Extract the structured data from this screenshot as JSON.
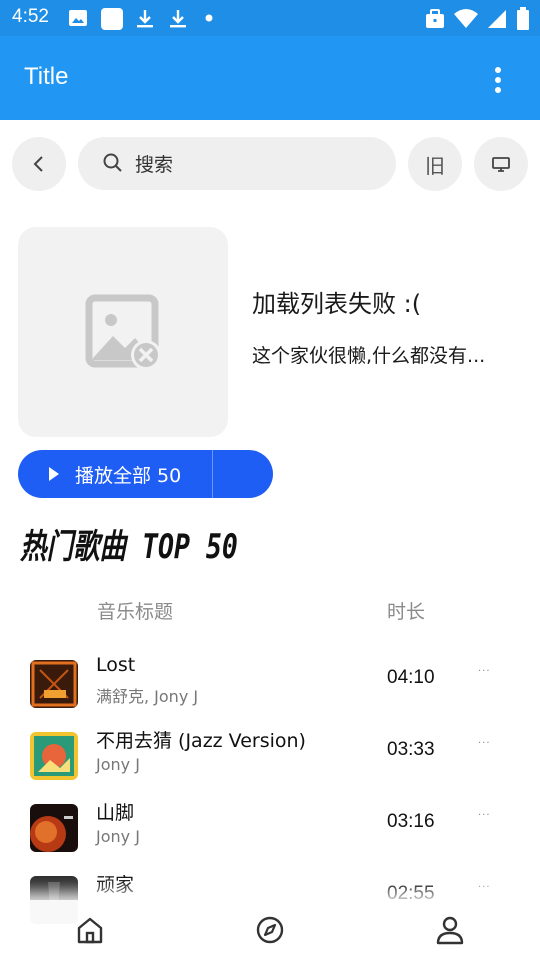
{
  "status_bar": {
    "time": "4:52",
    "icons": [
      "image-icon",
      "app-square-icon",
      "download-icon",
      "download-icon",
      "dot-icon",
      "briefcase-icon",
      "wifi-icon",
      "signal-icon",
      "battery-icon"
    ]
  },
  "app_bar": {
    "title": "Title",
    "menu_icon": "more-vert-icon"
  },
  "toolbar": {
    "back_icon": "chevron-left-icon",
    "search_placeholder": "搜索",
    "old_label": "旧",
    "desktop_icon": "monitor-icon"
  },
  "playlist": {
    "cover_icon": "broken-image-icon",
    "title": "加载列表失败 :(",
    "description": "这个家伙很懒,什么都没有..."
  },
  "play_all": {
    "label": "播放全部 50"
  },
  "section": {
    "title": "热门歌曲 TOP 50"
  },
  "columns": {
    "title": "音乐标题",
    "duration": "时长"
  },
  "songs": [
    {
      "name": "Lost",
      "artist": "满舒克, Jony J",
      "duration": "04:10",
      "more": "···"
    },
    {
      "name": "不用去猜 (Jazz Version)",
      "artist": "Jony J",
      "duration": "03:33",
      "more": "···"
    },
    {
      "name": "山脚",
      "artist": "Jony J",
      "duration": "03:16",
      "more": "···"
    },
    {
      "name": "顽家",
      "artist": "",
      "duration": "02:55",
      "more": "···"
    }
  ],
  "bottom_nav": {
    "items": [
      "home-icon",
      "compass-icon",
      "person-icon"
    ]
  },
  "colors": {
    "status_bar": "#1f8ee6",
    "app_bar": "#2196f3",
    "accent": "#1e5ef5"
  }
}
